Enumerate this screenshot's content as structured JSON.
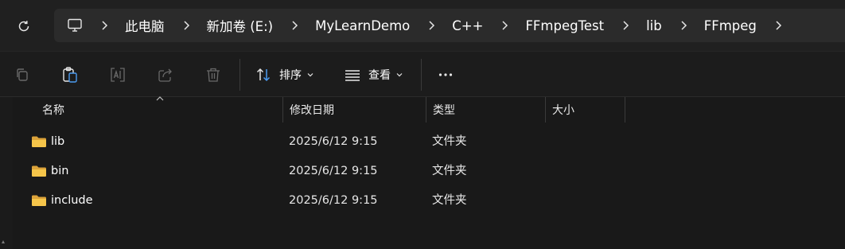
{
  "address_bar": {
    "breadcrumbs": [
      "此电脑",
      "新加卷 (E:)",
      "MyLearnDemo",
      "C++",
      "FFmpegTest",
      "lib",
      "FFmpeg"
    ]
  },
  "toolbar": {
    "sort_label": "排序",
    "view_label": "查看"
  },
  "columns": {
    "name": "名称",
    "date": "修改日期",
    "type": "类型",
    "size": "大小"
  },
  "files": [
    {
      "name": "lib",
      "modified": "2025/6/12 9:15",
      "type": "文件夹",
      "size": ""
    },
    {
      "name": "bin",
      "modified": "2025/6/12 9:15",
      "type": "文件夹",
      "size": ""
    },
    {
      "name": "include",
      "modified": "2025/6/12 9:15",
      "type": "文件夹",
      "size": ""
    }
  ],
  "colors": {
    "background": "#191919",
    "folder": "#f5c54a",
    "accent": "#4c9bf0"
  }
}
